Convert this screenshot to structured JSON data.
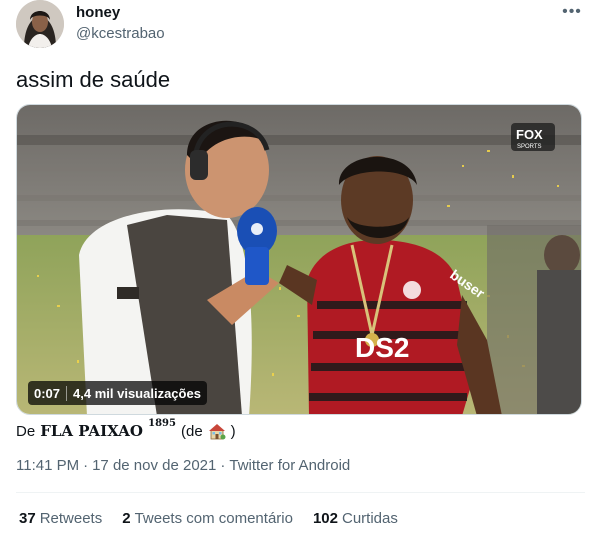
{
  "user": {
    "name": "honey",
    "handle": "@kcestrabao"
  },
  "tweet": {
    "text": "assim de saúde"
  },
  "media": {
    "duration": "0:07",
    "views": "4,4 mil visualizações",
    "broadcaster_logo": "FOX",
    "broadcaster_sub": "SPORTS",
    "shirt_text": "DS2",
    "shirt_sponsor": "buser"
  },
  "attribution": {
    "prefix": "De",
    "source": "FLA PAIXAO",
    "year": "1895",
    "suffix_open": "(de",
    "suffix_close": ")"
  },
  "meta": {
    "time": "11:41 PM",
    "separator": "·",
    "date": "17 de nov de 2021",
    "app": "Twitter for Android"
  },
  "stats": {
    "retweets_count": "37",
    "retweets_label": "Retweets",
    "quotes_count": "2",
    "quotes_label": "Tweets com comentário",
    "likes_count": "102",
    "likes_label": "Curtidas"
  },
  "icons": {
    "more": "more-horizontal-icon",
    "house": "house-emoji-icon"
  },
  "colors": {
    "text_primary": "#0f1419",
    "text_secondary": "#536471",
    "divider": "#eff3f4",
    "flamengo_red": "#c8102e"
  }
}
